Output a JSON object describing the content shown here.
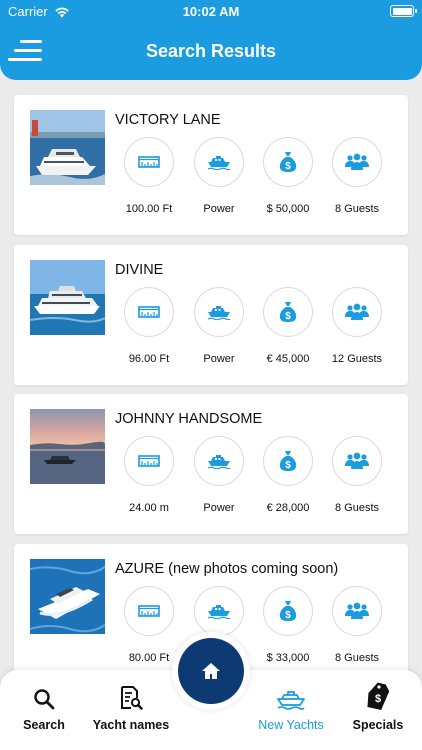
{
  "status": {
    "carrier": "Carrier",
    "time": "10:02 AM"
  },
  "header": {
    "title": "Search Results"
  },
  "colors": {
    "accent": "#1b9be0",
    "home": "#0e3a73"
  },
  "yachts": [
    {
      "name": "VICTORY LANE",
      "length": "100.00 Ft",
      "type": "Power",
      "price": "$ 50,000",
      "guests": "8 Guests"
    },
    {
      "name": "DIVINE",
      "length": "96.00 Ft",
      "type": "Power",
      "price": "€ 45,000",
      "guests": "12 Guests"
    },
    {
      "name": "JOHNNY HANDSOME",
      "length": "24.00 m",
      "type": "Power",
      "price": "€ 28,000",
      "guests": "8 Guests"
    },
    {
      "name": "AZURE (new photos coming soon)",
      "length": "80.00 Ft",
      "type": "Power",
      "price": "$ 33,000",
      "guests": "8 Guests"
    }
  ],
  "tabs": [
    {
      "label": "Search",
      "icon": "search-icon"
    },
    {
      "label": "Yacht names",
      "icon": "document-search-icon"
    },
    {
      "label": "New Yachts",
      "icon": "yacht-icon",
      "active": true
    },
    {
      "label": "Specials",
      "icon": "price-tag-icon"
    }
  ]
}
